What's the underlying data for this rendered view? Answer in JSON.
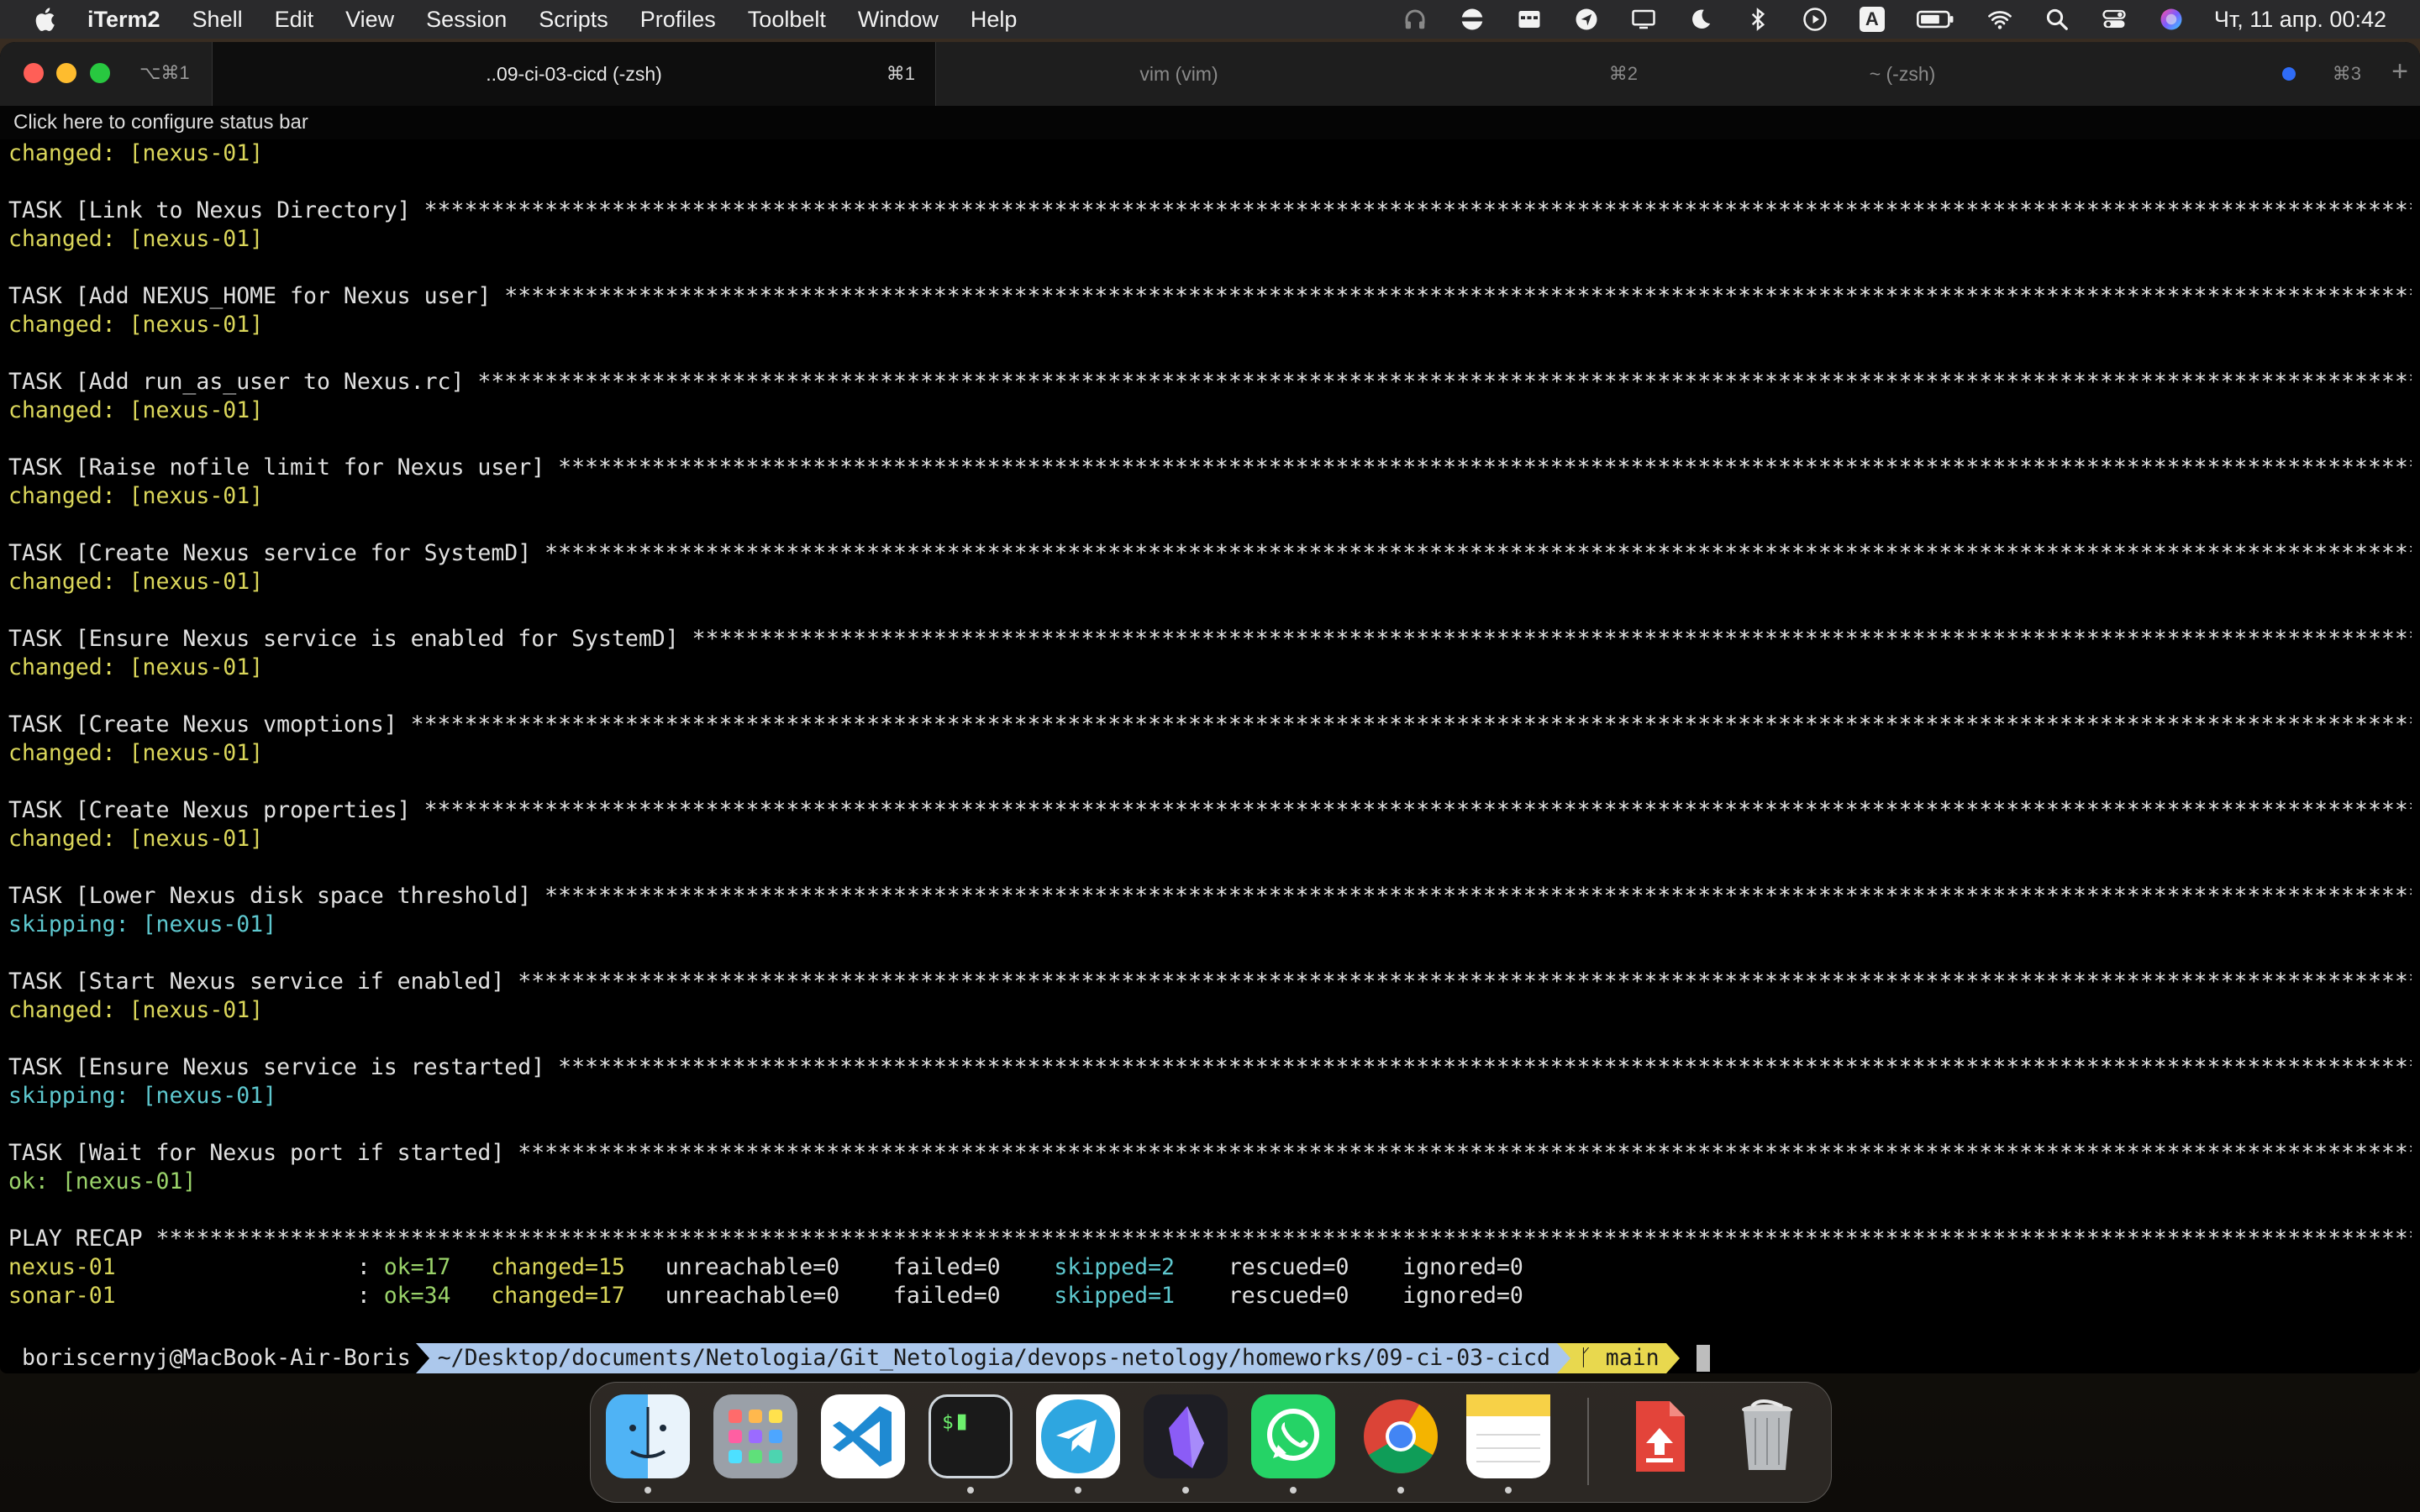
{
  "menubar": {
    "app_name": "iTerm2",
    "items": [
      "Shell",
      "Edit",
      "View",
      "Session",
      "Scripts",
      "Profiles",
      "Toolbelt",
      "Window",
      "Help"
    ],
    "clock": "Чт, 11 апр.  00:42",
    "input_source": "A"
  },
  "window": {
    "shortcut": "⌥⌘1",
    "tabs": [
      {
        "label": "..09-ci-03-cicd (-zsh)",
        "shortcut": "⌘1",
        "active": true
      },
      {
        "label": "vim (vim)",
        "shortcut": "⌘2",
        "active": false
      },
      {
        "label": "~ (-zsh)",
        "shortcut": "⌘3",
        "active": false
      }
    ],
    "new_tab": "+",
    "status_bar_hint": "Click here to configure status bar"
  },
  "terminal": {
    "lines": [
      {
        "text": "changed: [nexus-01]",
        "color": "yellow"
      },
      {
        "text": "",
        "color": "white"
      },
      {
        "text": "TASK [Link to Nexus Directory] *************************************************************************************************************************************************************************************",
        "color": "white"
      },
      {
        "text": "changed: [nexus-01]",
        "color": "yellow"
      },
      {
        "text": "",
        "color": "white"
      },
      {
        "text": "TASK [Add NEXUS_HOME for Nexus user] *******************************************************************************************************************************************************************************",
        "color": "white"
      },
      {
        "text": "changed: [nexus-01]",
        "color": "yellow"
      },
      {
        "text": "",
        "color": "white"
      },
      {
        "text": "TASK [Add run_as_user to Nexus.rc] *********************************************************************************************************************************************************************************",
        "color": "white"
      },
      {
        "text": "changed: [nexus-01]",
        "color": "yellow"
      },
      {
        "text": "",
        "color": "white"
      },
      {
        "text": "TASK [Raise nofile limit for Nexus user] ***************************************************************************************************************************************************************************",
        "color": "white"
      },
      {
        "text": "changed: [nexus-01]",
        "color": "yellow"
      },
      {
        "text": "",
        "color": "white"
      },
      {
        "text": "TASK [Create Nexus service for SystemD] ****************************************************************************************************************************************************************************",
        "color": "white"
      },
      {
        "text": "changed: [nexus-01]",
        "color": "yellow"
      },
      {
        "text": "",
        "color": "white"
      },
      {
        "text": "TASK [Ensure Nexus service is enabled for SystemD] *****************************************************************************************************************************************************************",
        "color": "white"
      },
      {
        "text": "changed: [nexus-01]",
        "color": "yellow"
      },
      {
        "text": "",
        "color": "white"
      },
      {
        "text": "TASK [Create Nexus vmoptions] **************************************************************************************************************************************************************************************",
        "color": "white"
      },
      {
        "text": "changed: [nexus-01]",
        "color": "yellow"
      },
      {
        "text": "",
        "color": "white"
      },
      {
        "text": "TASK [Create Nexus properties] *************************************************************************************************************************************************************************************",
        "color": "white"
      },
      {
        "text": "changed: [nexus-01]",
        "color": "yellow"
      },
      {
        "text": "",
        "color": "white"
      },
      {
        "text": "TASK [Lower Nexus disk space threshold] ****************************************************************************************************************************************************************************",
        "color": "white"
      },
      {
        "text": "skipping: [nexus-01]",
        "color": "cyan"
      },
      {
        "text": "",
        "color": "white"
      },
      {
        "text": "TASK [Start Nexus service if enabled] ******************************************************************************************************************************************************************************",
        "color": "white"
      },
      {
        "text": "changed: [nexus-01]",
        "color": "yellow"
      },
      {
        "text": "",
        "color": "white"
      },
      {
        "text": "TASK [Ensure Nexus service is restarted] ***************************************************************************************************************************************************************************",
        "color": "white"
      },
      {
        "text": "skipping: [nexus-01]",
        "color": "cyan"
      },
      {
        "text": "",
        "color": "white"
      },
      {
        "text": "TASK [Wait for Nexus port if started] ******************************************************************************************************************************************************************************",
        "color": "white"
      },
      {
        "text": "ok: [nexus-01]",
        "color": "green"
      },
      {
        "text": "",
        "color": "white"
      },
      {
        "text": "PLAY RECAP *****************************************************************************************************************************************************************************************************",
        "color": "white"
      }
    ],
    "recap": [
      {
        "host": "nexus-01",
        "ok": "ok=17",
        "changed": "changed=15",
        "unreachable": "unreachable=0",
        "failed": "failed=0",
        "skipped": "skipped=2",
        "rescued": "rescued=0",
        "ignored": "ignored=0"
      },
      {
        "host": "sonar-01",
        "ok": "ok=34",
        "changed": "changed=17",
        "unreachable": "unreachable=0",
        "failed": "failed=0",
        "skipped": "skipped=1",
        "rescued": "rescued=0",
        "ignored": "ignored=0"
      }
    ],
    "prompt": {
      "user": "boriscernyj@MacBook-Air-Boris",
      "path": "~/Desktop/documents/Netologia/Git_Netologia/devops-netology/homeworks/09-ci-03-cicd",
      "branch": " main"
    }
  },
  "colors": {
    "yellow": "#dad65a",
    "cyan": "#5ec8cf",
    "green": "#9ad36a",
    "white": "#e0e0e0"
  },
  "dock": {
    "apps": [
      {
        "icon": "finder-icon",
        "running": true
      },
      {
        "icon": "launchpad-icon",
        "running": false
      },
      {
        "icon": "vscode-icon",
        "running": false
      },
      {
        "icon": "iterm-icon",
        "running": true
      },
      {
        "icon": "telegram-icon",
        "running": true
      },
      {
        "icon": "obsidian-icon",
        "running": true
      },
      {
        "icon": "whatsapp-icon",
        "running": true
      },
      {
        "icon": "chrome-icon",
        "running": true
      },
      {
        "icon": "notes-icon",
        "running": true
      },
      {
        "icon": "downloads-stack-icon",
        "running": false
      },
      {
        "icon": "trash-icon",
        "running": false
      }
    ]
  }
}
